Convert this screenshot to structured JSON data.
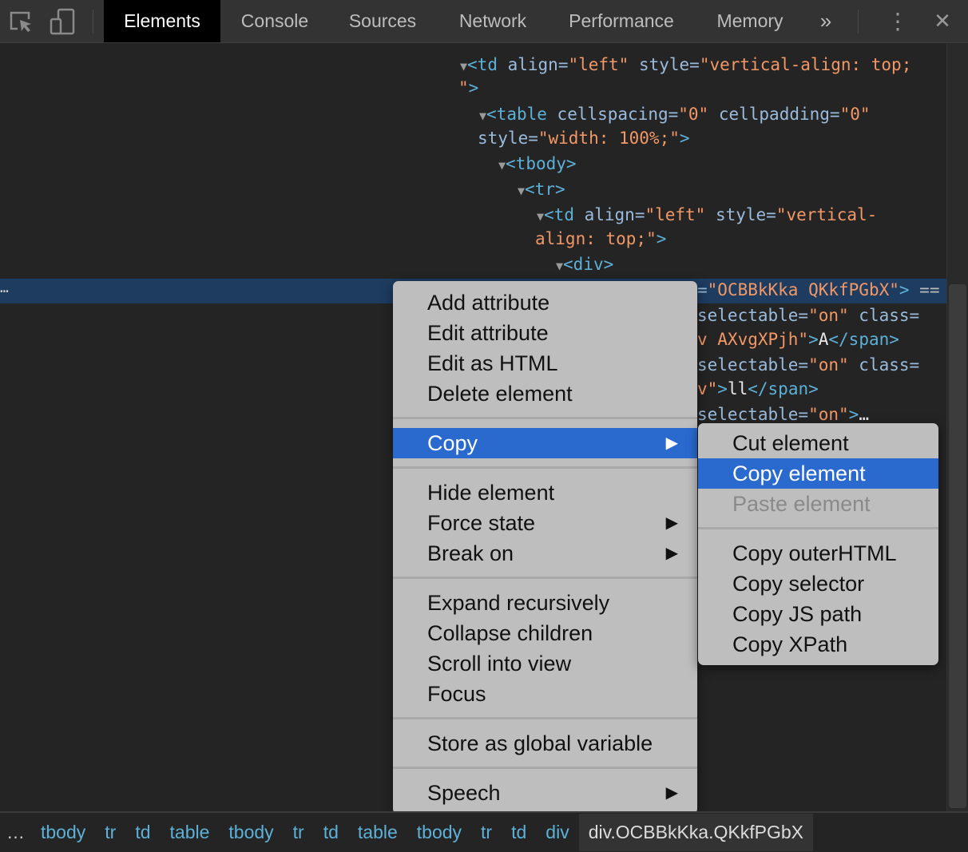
{
  "toolbar": {
    "icons": [
      "inspect-element-icon",
      "device-toolbar-icon",
      "more-tabs-icon",
      "kebab-menu-icon",
      "close-icon"
    ],
    "tabs": [
      "Elements",
      "Console",
      "Sources",
      "Network",
      "Performance",
      "Memory"
    ],
    "active_tab": "Elements",
    "more_tabs": "»",
    "kebab": "⋮",
    "close": "✕"
  },
  "dom_tree": {
    "selected_dots": "…",
    "lines": [
      [
        {
          "k": "tri",
          "t": "▼"
        },
        {
          "k": "tag",
          "t": "<td "
        },
        {
          "k": "an",
          "t": "align="
        },
        {
          "k": "av",
          "t": "\"left\""
        },
        {
          "k": "an",
          "t": " style="
        },
        {
          "k": "av",
          "t": "\"vertical-align: top;"
        }
      ],
      [
        {
          "k": "av",
          "t": "\""
        },
        {
          "k": "tag",
          "t": ">"
        }
      ],
      [
        {
          "k": "tri",
          "t": "▼"
        },
        {
          "k": "tag",
          "t": "<table "
        },
        {
          "k": "an",
          "t": "cellspacing="
        },
        {
          "k": "av",
          "t": "\"0\""
        },
        {
          "k": "an",
          "t": " cellpadding="
        },
        {
          "k": "av",
          "t": "\"0\""
        }
      ],
      [
        {
          "k": "an",
          "t": "style="
        },
        {
          "k": "av",
          "t": "\"width: 100%;\""
        },
        {
          "k": "tag",
          "t": ">"
        }
      ],
      [
        {
          "k": "tri",
          "t": "▼"
        },
        {
          "k": "tag",
          "t": "<tbody>"
        }
      ],
      [
        {
          "k": "tri",
          "t": "▼"
        },
        {
          "k": "tag",
          "t": "<tr>"
        }
      ],
      [
        {
          "k": "tri",
          "t": "▼"
        },
        {
          "k": "tag",
          "t": "<td "
        },
        {
          "k": "an",
          "t": "align="
        },
        {
          "k": "av",
          "t": "\"left\""
        },
        {
          "k": "an",
          "t": " style="
        },
        {
          "k": "av",
          "t": "\"vertical-"
        }
      ],
      [
        {
          "k": "av",
          "t": "align: top;\""
        },
        {
          "k": "tag",
          "t": ">"
        }
      ],
      [
        {
          "k": "tri",
          "t": "▼"
        },
        {
          "k": "tag",
          "t": "<div>"
        }
      ],
      [
        {
          "k": "an",
          "t": "="
        },
        {
          "k": "av",
          "t": "\"OCBBkKka QKkfPGbX\""
        },
        {
          "k": "tag",
          "t": ">"
        },
        {
          "k": "dim",
          "t": " =="
        }
      ],
      [
        {
          "k": "an",
          "t": "selectable="
        },
        {
          "k": "av",
          "t": "\"on\""
        },
        {
          "k": "an",
          "t": " class="
        }
      ],
      [
        {
          "k": "av",
          "t": "v AXvgXPjh\""
        },
        {
          "k": "tag",
          "t": ">"
        },
        {
          "k": "tx",
          "t": "A"
        },
        {
          "k": "tag",
          "t": "</span>"
        }
      ],
      [
        {
          "k": "an",
          "t": "selectable="
        },
        {
          "k": "av",
          "t": "\"on\""
        },
        {
          "k": "an",
          "t": " class="
        }
      ],
      [
        {
          "k": "av",
          "t": "v\""
        },
        {
          "k": "tag",
          "t": ">"
        },
        {
          "k": "tx",
          "t": "ll"
        },
        {
          "k": "tag",
          "t": "</span>"
        }
      ],
      [
        {
          "k": "an",
          "t": "selectable="
        },
        {
          "k": "av",
          "t": "\"on\""
        },
        {
          "k": "tag",
          "t": ">"
        },
        {
          "k": "tx",
          "t": "…"
        }
      ]
    ]
  },
  "context_menu": {
    "groups": [
      [
        {
          "label": "Add attribute"
        },
        {
          "label": "Edit attribute"
        },
        {
          "label": "Edit as HTML"
        },
        {
          "label": "Delete element"
        }
      ],
      [
        {
          "label": "Copy",
          "submenu": true,
          "highlighted": true
        }
      ],
      [
        {
          "label": "Hide element"
        },
        {
          "label": "Force state",
          "submenu": true
        },
        {
          "label": "Break on",
          "submenu": true
        }
      ],
      [
        {
          "label": "Expand recursively"
        },
        {
          "label": "Collapse children"
        },
        {
          "label": "Scroll into view"
        },
        {
          "label": "Focus"
        }
      ],
      [
        {
          "label": "Store as global variable"
        }
      ],
      [
        {
          "label": "Speech",
          "submenu": true
        }
      ]
    ],
    "submenu_arrow": "▶"
  },
  "copy_submenu": {
    "groups": [
      [
        {
          "label": "Cut element"
        },
        {
          "label": "Copy element",
          "highlighted": true
        },
        {
          "label": "Paste element",
          "disabled": true
        }
      ],
      [
        {
          "label": "Copy outerHTML"
        },
        {
          "label": "Copy selector"
        },
        {
          "label": "Copy JS path"
        },
        {
          "label": "Copy XPath"
        }
      ]
    ]
  },
  "breadcrumbs": {
    "more": "…",
    "items": [
      "tbody",
      "tr",
      "td",
      "table",
      "tbody",
      "tr",
      "td",
      "table",
      "tbody",
      "tr",
      "td",
      "div"
    ],
    "selected": "div.OCBBkKka.QKkfPGbX"
  },
  "colors": {
    "highlight": "#2a6acf",
    "tag": "#5db0d7",
    "attr_name": "#9bbbdc",
    "attr_value": "#f29766",
    "selected_row": "#1d3c60"
  }
}
